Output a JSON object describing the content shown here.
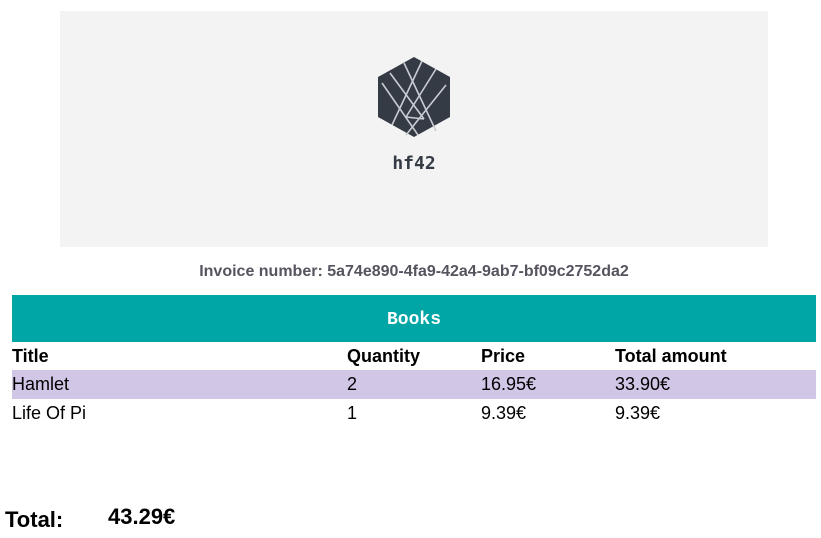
{
  "header": {
    "brand_name": "hf42",
    "logo_icon": "hexagon-logo-icon",
    "logo_color": "#353b45",
    "background": "#f3f3f3"
  },
  "invoice": {
    "number_text": "Invoice number: 5a74e890-4fa9-42a4-9ab7-bf09c2752da2"
  },
  "section": {
    "title": "Books",
    "bar_color": "#00a5a5"
  },
  "table": {
    "columns": [
      "Title",
      "Quantity",
      "Price",
      "Total amount"
    ],
    "rows": [
      {
        "title": "Hamlet",
        "quantity": "2",
        "price": "16.95€",
        "total": "33.90€"
      },
      {
        "title": "Life Of Pi",
        "quantity": "1",
        "price": "9.39€",
        "total": "9.39€"
      }
    ],
    "stripe_color": "#d2c6e7"
  },
  "summary": {
    "total_label": "Total:",
    "total_value": "43.29€"
  }
}
